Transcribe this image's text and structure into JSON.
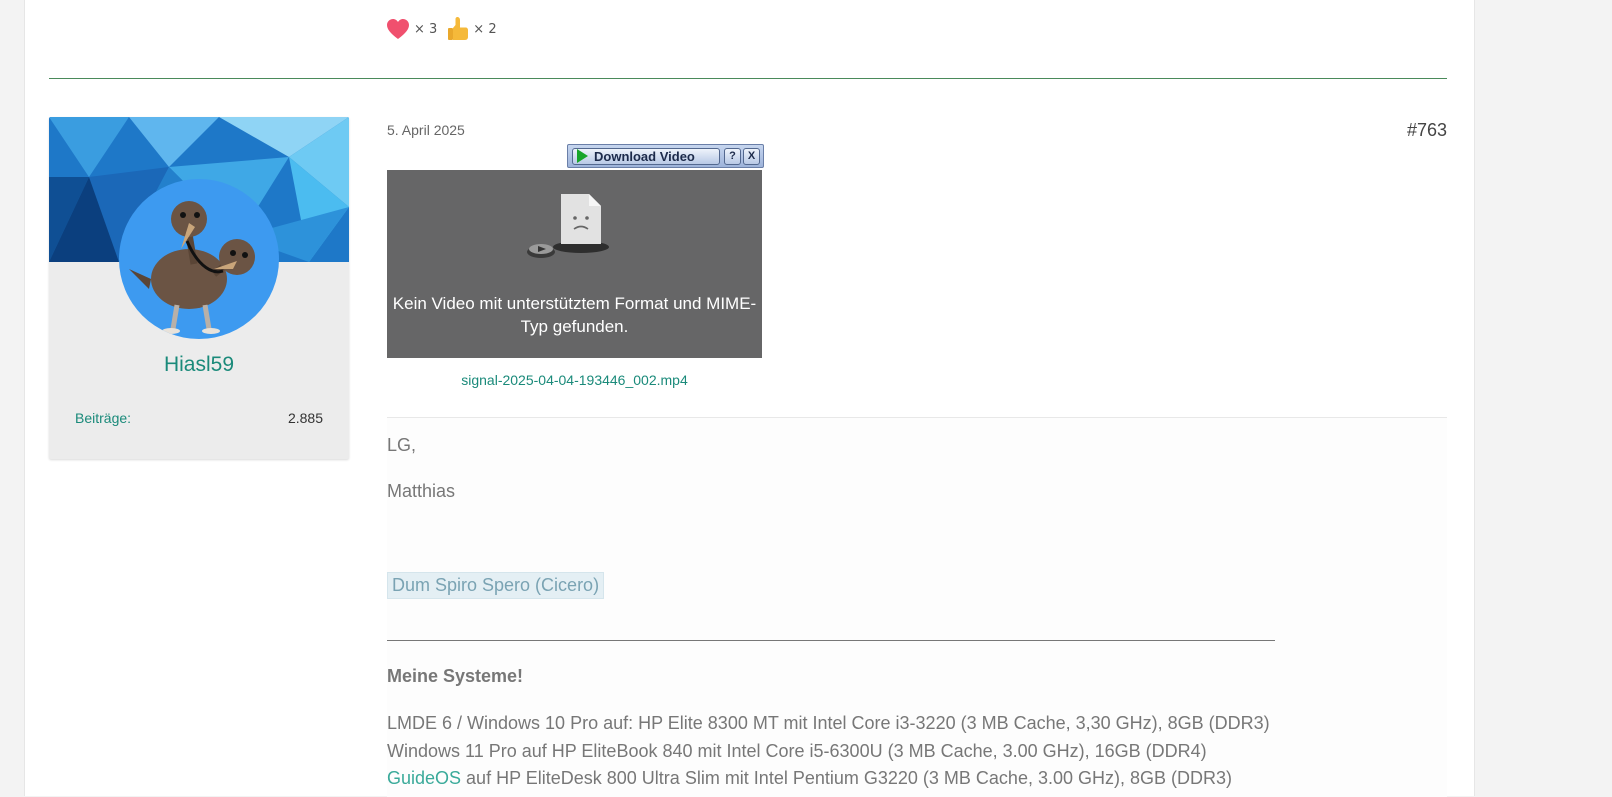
{
  "reactions": [
    {
      "icon": "heart-icon",
      "count": "× 3"
    },
    {
      "icon": "thumbs-up-icon",
      "count": "× 2"
    }
  ],
  "user": {
    "name": "Hiasl59",
    "stat_label": "Beiträge:",
    "stat_value": "2.885"
  },
  "post": {
    "date": "5. April 2025",
    "number": "#763",
    "download_label": "Download Video",
    "help_label": "?",
    "close_label": "X",
    "video_message": "Kein Video mit unterstütztem Format und MIME-Typ gefunden.",
    "file_name": "signal-2025-04-04-193446_002.mp4"
  },
  "signature": {
    "greeting": "LG,",
    "name": "Matthias",
    "quote": "Dum Spiro Spero (Cicero)",
    "systems_title": "Meine Systeme!",
    "system1": "LMDE 6 / Windows 10 Pro auf: HP Elite 8300 MT mit Intel Core i3-3220 (3 MB Cache, 3,30 GHz), 8GB (DDR3)",
    "system2": "Windows 11 Pro auf HP EliteBook 840 mit Intel Core i5-6300U (3 MB Cache, 3.00 GHz), 16GB (DDR4)",
    "system3_link": "GuideOS",
    "system3_rest": " auf HP EliteDesk 800 Ultra Slim mit Intel Pentium G3220 (3 MB Cache, 3.00 GHz), 8GB (DDR3)"
  },
  "colors": {
    "accent": "#1a8a7a",
    "divider": "#4a8a5a",
    "avatar_bg": "#3d9af0"
  }
}
